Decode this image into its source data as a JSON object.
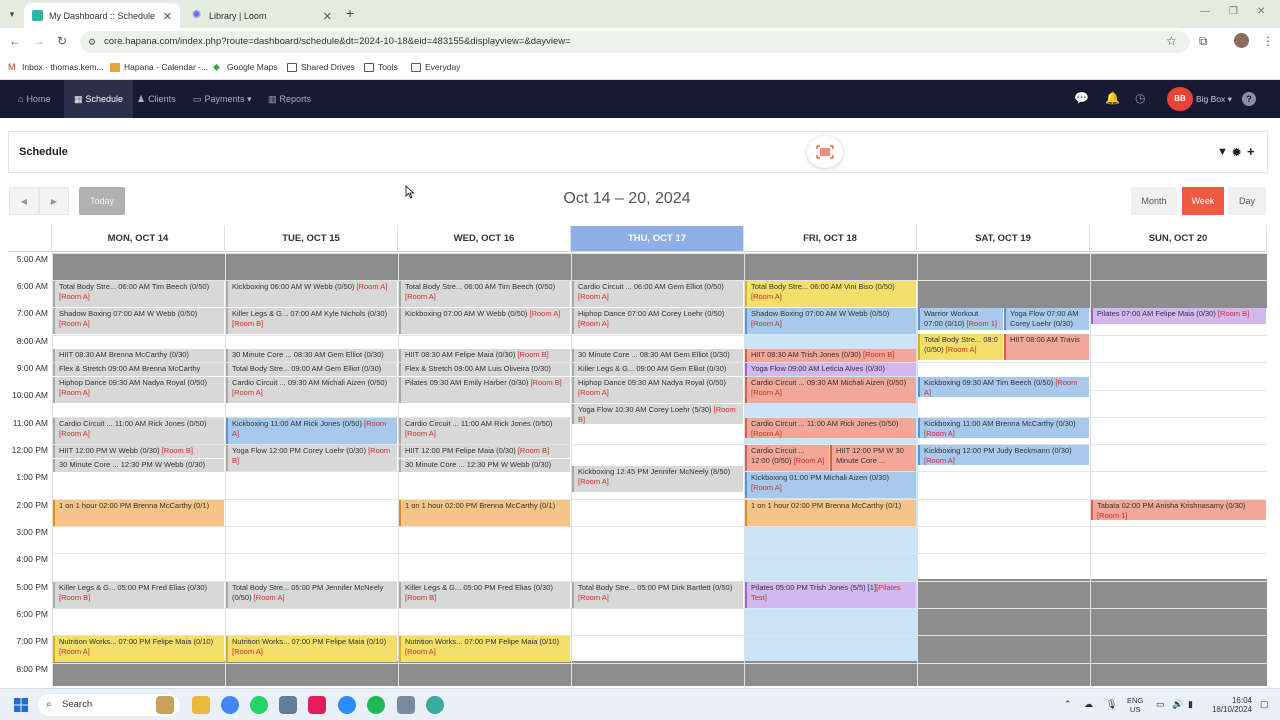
{
  "browser": {
    "tabs": [
      {
        "title": "My Dashboard :: Schedule",
        "active": true
      },
      {
        "title": "Library | Loom",
        "active": false
      }
    ],
    "url": "core.hapana.com/index.php?route=dashboard/schedule&dt=2024-10-18&eid=483155&displayview=&dayview=",
    "bookmarks": [
      "Inbox - thomas.kem...",
      "Hapana - Calendar -...",
      "Google Maps",
      "Shared Drives",
      "Tools",
      "Everyday"
    ]
  },
  "app_nav": {
    "items": [
      "Home",
      "Schedule",
      "Clients",
      "Payments",
      "Reports"
    ],
    "active": "Schedule",
    "user_initials": "BB",
    "user_name": "Big Box"
  },
  "panel": {
    "title": "Schedule"
  },
  "calendar": {
    "range_title": "Oct 14 – 20, 2024",
    "today_label": "Today",
    "views": [
      "Month",
      "Week",
      "Day"
    ],
    "active_view": "Week",
    "days": [
      "MON, OCT 14",
      "TUE, OCT 15",
      "WED, OCT 16",
      "THU, OCT 17",
      "FRI, OCT 18",
      "SAT, OCT 19",
      "SUN, OCT 20"
    ],
    "today_index": 3,
    "hours": [
      "5:00 AM",
      "6:00 AM",
      "7:00 AM",
      "8:00 AM",
      "9:00 AM",
      "10:00 AM",
      "11:00 AM",
      "12:00 PM",
      "1:00 PM",
      "2:00 PM",
      "3:00 PM",
      "4:00 PM",
      "5:00 PM",
      "6:00 PM",
      "7:00 PM",
      "8:00 PM"
    ],
    "events": [
      {
        "text": "Total Body Stre... 06:00 AM Tim Beech (0/50)",
        "room": "[Room A]"
      },
      {
        "text": "Shadow Boxing 07:00 AM W Webb (0/50)",
        "room": "[Room A]"
      },
      {
        "text": "HIIT 08:30 AM Brenna McCarthy (0/30)",
        "room": ""
      },
      {
        "text": "Flex & Stretch 09:00 AM Brenna McCarthy",
        "room": ""
      },
      {
        "text": "Hiphop Dance 09:30 AM Nadya Royal (0/50)",
        "room": "[Room A]"
      },
      {
        "text": "Cardio Circuit ... 11:00 AM Rick Jones (0/50)",
        "room": "[Room A]"
      },
      {
        "text": "HIIT 12:00 PM W Webb (0/30)",
        "room": "[Room B]"
      },
      {
        "text": "30 Minute Core ... 12:30 PM W Webb (0/30)",
        "room": ""
      },
      {
        "text": "1 on 1 hour 02:00 PM Brenna McCarthy (0/1)",
        "room": ""
      },
      {
        "text": "Killer Legs & G... 05:00 PM Fred Elias (0/30)",
        "room": "[Room B]"
      },
      {
        "text": "Nutrition Works... 07:00 PM Felipe Maia (0/10)",
        "room": "[Room A]"
      },
      {
        "text": "Kickboxing 06:00 AM W Webb (0/50)",
        "room": "[Room A]"
      },
      {
        "text": "Killer Legs & G... 07:00 AM Kyle Nichols (0/30)",
        "room": "[Room B]"
      },
      {
        "text": "30 Minute Core ... 08:30 AM Gem Elliot (0/30)",
        "room": ""
      },
      {
        "text": "Total Body Stre... 09:00 AM Gem Elliot (0/30)",
        "room": ""
      },
      {
        "text": "Cardio Circuit ... 09:30 AM Michali Aizen (0/50)",
        "room": "[Room A]"
      },
      {
        "text": "Kickboxing 11:00 AM Rick Jones (0/50)",
        "room": "[Room A]"
      },
      {
        "text": "Yoga Flow 12:00 PM Corey Loehr (0/30)",
        "room": "[Room B]"
      },
      {
        "text": "Total Body Stre... 05:00 PM Jennifer McNeely (0/50)",
        "room": "[Room A]"
      },
      {
        "text": "Nutrition Works... 07:00 PM Felipe Maia (0/10)",
        "room": "[Room A]"
      },
      {
        "text": "Total Body Stre... 06:00 AM Tim Beech (0/50)",
        "room": "[Room A]"
      },
      {
        "text": "Kickboxing 07:00 AM W Webb (0/50)",
        "room": "[Room A]"
      },
      {
        "text": "HIIT 08:30 AM Felipe Maia (0/30)",
        "room": "[Room B]"
      },
      {
        "text": "Flex & Stretch 09:00 AM Luis Oliveira (0/30)",
        "room": ""
      },
      {
        "text": "Pilates 09:30 AM Emily Harber (0/30)",
        "room": "[Room B]"
      },
      {
        "text": "Cardio Circuit ... 11:00 AM Rick Jones (0/50)",
        "room": "[Room A]"
      },
      {
        "text": "HIIT 12:00 PM Felipe Maia (0/30)",
        "room": "[Room B]"
      },
      {
        "text": "30 Minute Core ... 12:30 PM W Webb (0/30)",
        "room": ""
      },
      {
        "text": "1 on 1 hour 02:00 PM Brenna McCarthy (0/1)",
        "room": ""
      },
      {
        "text": "Killer Legs & G... 05:00 PM Fred Elias (0/30)",
        "room": "[Room B]"
      },
      {
        "text": "Nutrition Works... 07:00 PM Felipe Maia (0/10)",
        "room": "[Room A]"
      },
      {
        "text": "Cardio Circuit ... 06:00 AM Gem Elliot (0/50)",
        "room": "[Room A]"
      },
      {
        "text": "Hiphop Dance 07:00 AM Corey Loehr (0/50)",
        "room": "[Room A]"
      },
      {
        "text": "30 Minute Core ... 08:30 AM Gem Elliot (0/30)",
        "room": ""
      },
      {
        "text": "Killer Legs & G... 09:00 AM Gem Elliot (0/30)",
        "room": ""
      },
      {
        "text": "Hiphop Dance 09:30 AM Nadya Royal (0/50)",
        "room": "[Room A]"
      },
      {
        "text": "Yoga Flow 10:30 AM Corey Loehr (5/30)",
        "room": "[Room B]"
      },
      {
        "text": "Kickboxing 12:45 PM Jennifer McNeely (8/50)",
        "room": "[Room A]"
      },
      {
        "text": "Total Body Stre... 05:00 PM Dirk Bartlett (0/50)",
        "room": "[Room A]"
      },
      {
        "text": "Total Body Stre... 06:00 AM Vini Biso (0/50)",
        "room": "[Room A]"
      },
      {
        "text": "Shadow Boxing 07:00 AM W Webb (0/50)",
        "room": "[Room A]"
      },
      {
        "text": "HIIT 08:30 AM Trish Jones (0/30)",
        "room": "[Room B]"
      },
      {
        "text": "Yoga Flow 09:00 AM Leticia Alves (0/30)",
        "room": ""
      },
      {
        "text": "Cardio Circuit ... 09:30 AM Michali Aizen (0/50)",
        "room": "[Room A]"
      },
      {
        "text": "Cardio Circuit ... 11:00 AM Rick Jones (0/50)",
        "room": "[Room A]"
      },
      {
        "text": "Cardio Circuit ... 12:00 (0/50)",
        "room": "[Room A]"
      },
      {
        "text": "HIIT 12:00 PM W 30 Minute Core ...",
        "room": ""
      },
      {
        "text": "Kickboxing 01:00 PM Michali Aizen (0/30)",
        "room": "[Room A]"
      },
      {
        "text": "1 on 1 hour 02:00 PM Brenna McCarthy (0/1)",
        "room": ""
      },
      {
        "text": "Pilates 05:00 PM Trish Jones (5/5) [1]",
        "room": "[Pilates Test]"
      },
      {
        "text": "Warrior Workout 07:00 (0/10)",
        "room": "[Room 1]"
      },
      {
        "text": "Yoga Flow 07:00 AM Corey Loehr (0/30)",
        "room": ""
      },
      {
        "text": "Total Body Stre... 08:0 (0/50)",
        "room": "[Room A]"
      },
      {
        "text": "HIIT 08:00 AM Travis",
        "room": ""
      },
      {
        "text": "Kickboxing 09:30 AM Tim Beech (0/50)",
        "room": "[Room A]"
      },
      {
        "text": "Kickboxing 11:00 AM Brenna McCarthy (0/30)",
        "room": "[Room A]"
      },
      {
        "text": "Kickboxing 12:00 PM Judy Beckmann (0/30)",
        "room": "[Room A]"
      },
      {
        "text": "Pilates 07:00 AM Felipe Maia (0/30)",
        "room": "[Room B]"
      },
      {
        "text": "Tabata 02:00 PM Anisha Krishnasamy (0/30)",
        "room": "[Room 1]"
      }
    ]
  },
  "taskbar": {
    "search_placeholder": "Search",
    "lang_1": "ENG",
    "lang_2": "US",
    "time": "16:04",
    "date": "18/10/2024"
  }
}
